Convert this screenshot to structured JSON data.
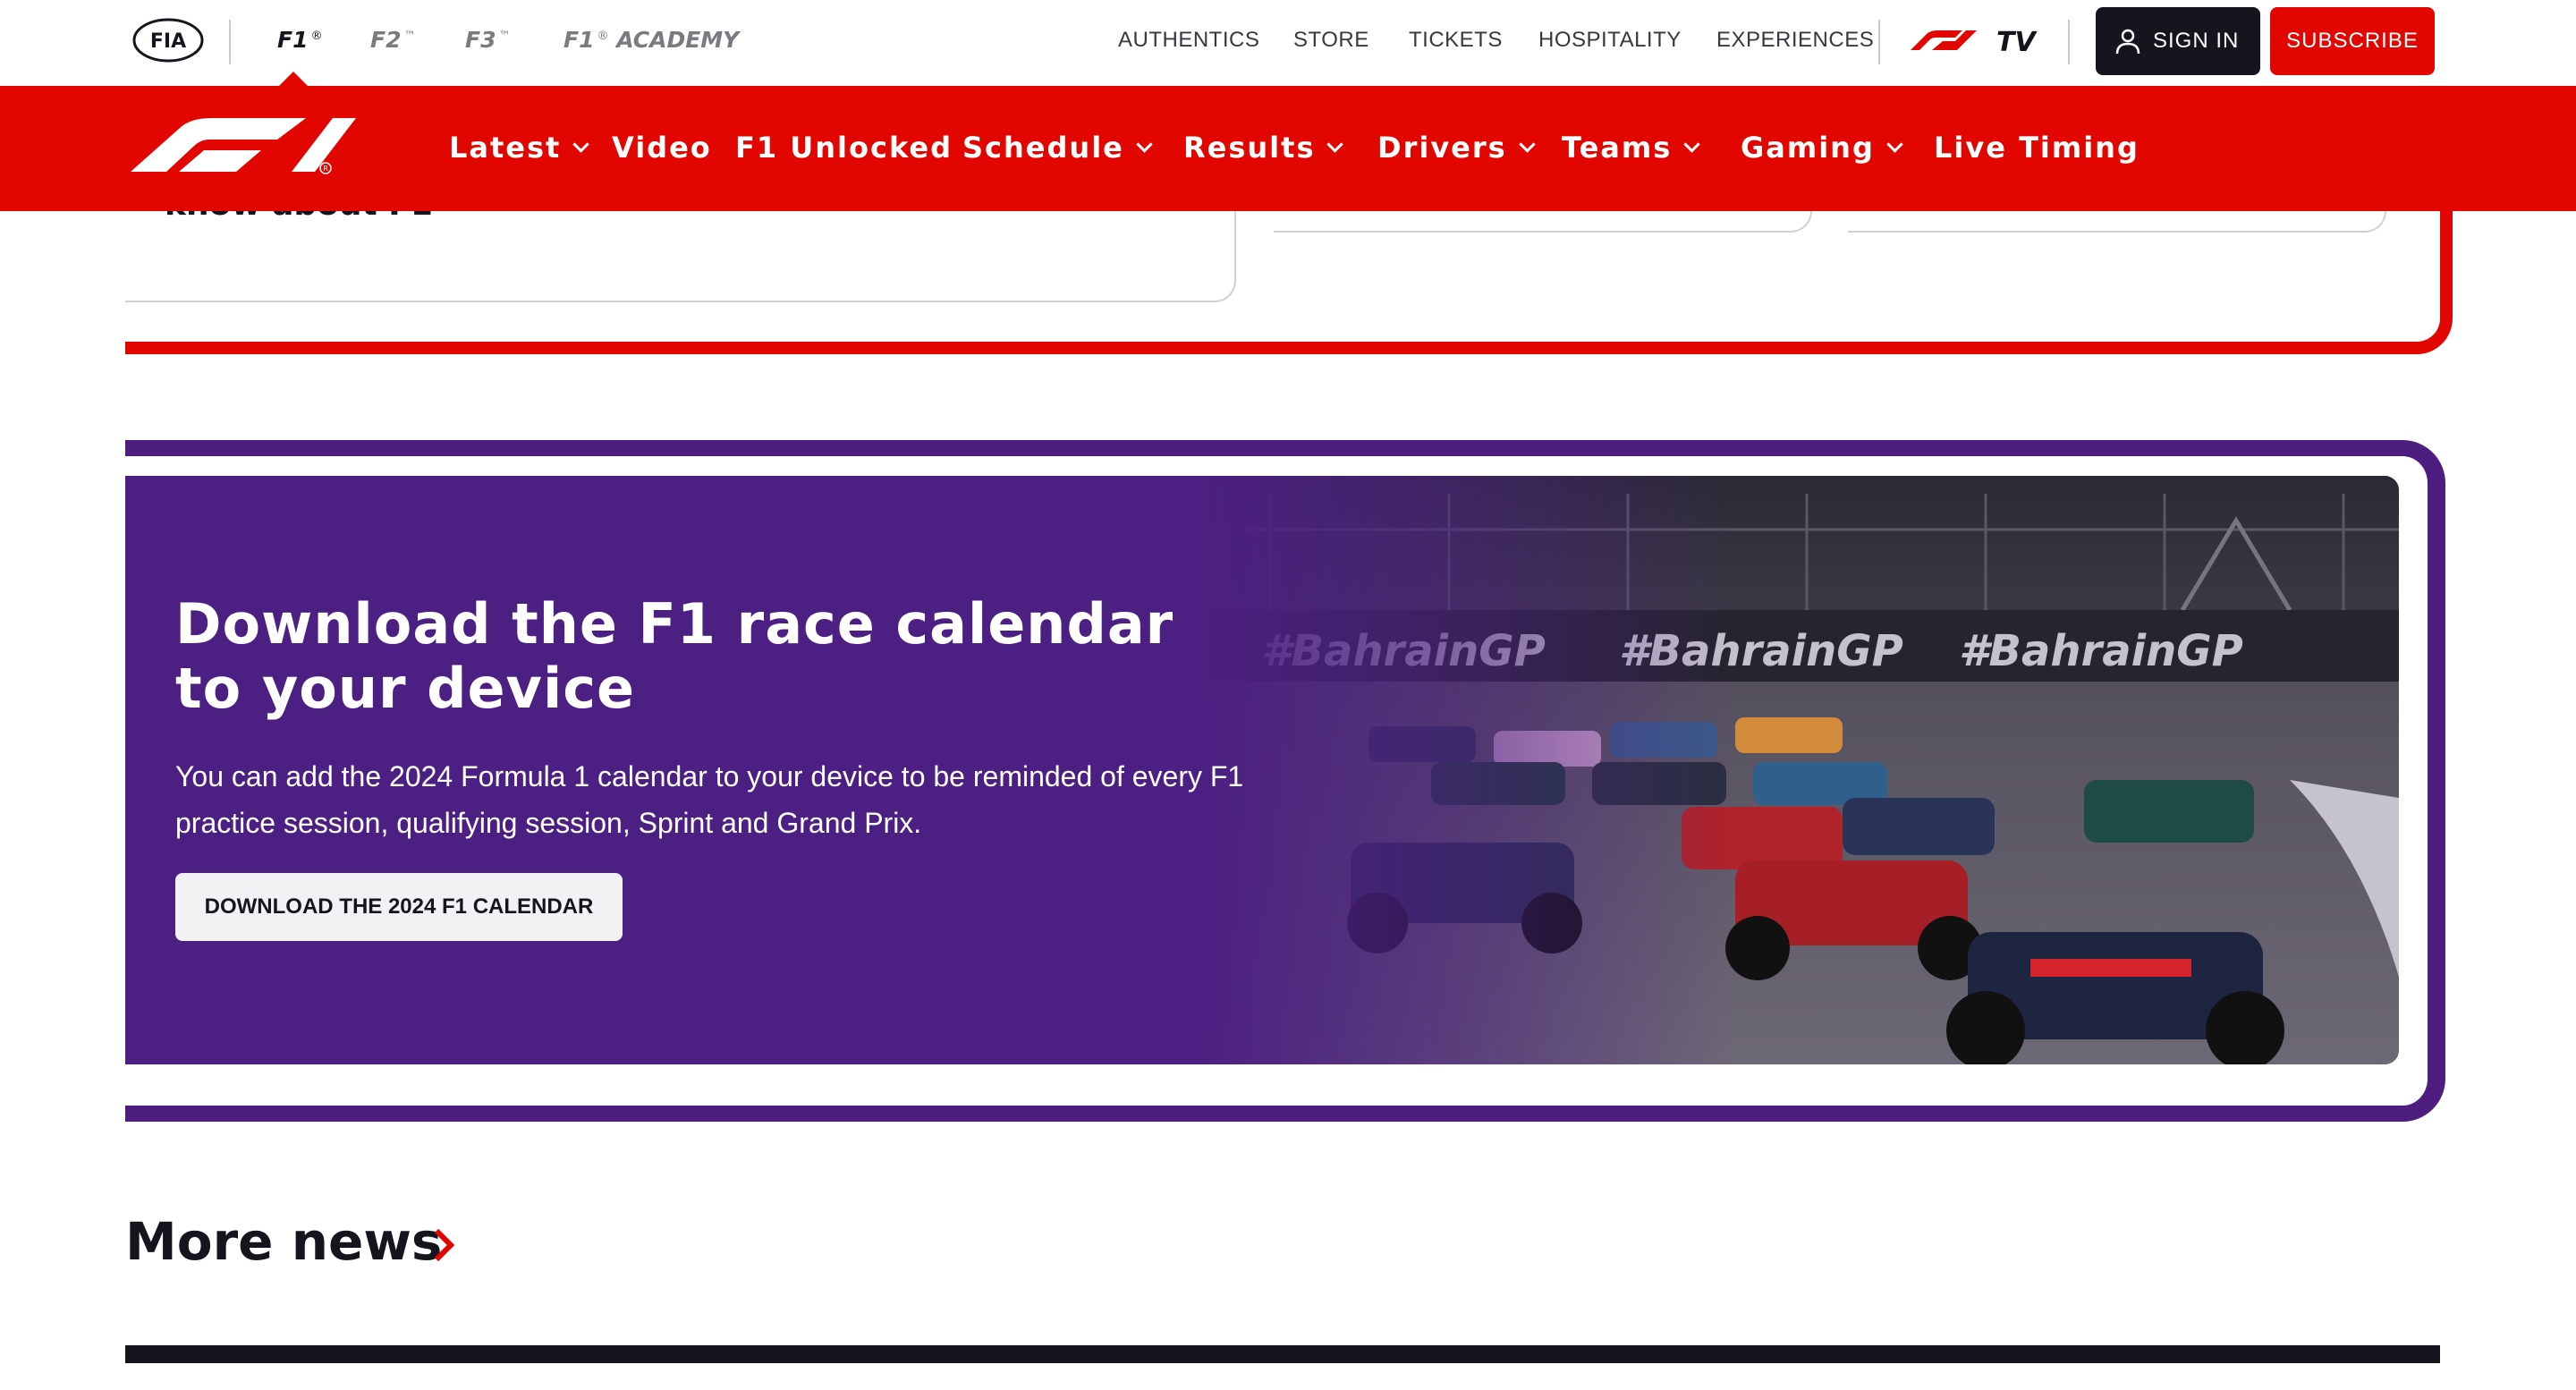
{
  "topbar": {
    "fia_logo_text": "FIA",
    "series": [
      {
        "label": "F1",
        "mark": "®"
      },
      {
        "label": "F2",
        "mark": "™"
      },
      {
        "label": "F3",
        "mark": "™"
      },
      {
        "label": "F1",
        "mark": "®",
        "suffix": "ACADEMY"
      }
    ],
    "links": [
      "AUTHENTICS",
      "STORE",
      "TICKETS",
      "HOSPITALITY",
      "EXPERIENCES"
    ],
    "f1tv_label": "TV",
    "signin_label": "SIGN IN",
    "subscribe_label": "SUBSCRIBE"
  },
  "nav": {
    "items": [
      {
        "label": "Latest",
        "dropdown": true
      },
      {
        "label": "Video",
        "dropdown": false
      },
      {
        "label": "F1 Unlocked",
        "dropdown": false
      },
      {
        "label": "Schedule",
        "dropdown": true
      },
      {
        "label": "Results",
        "dropdown": true
      },
      {
        "label": "Drivers",
        "dropdown": true
      },
      {
        "label": "Teams",
        "dropdown": true
      },
      {
        "label": "Gaming",
        "dropdown": true
      },
      {
        "label": "Live Timing",
        "dropdown": false
      }
    ]
  },
  "partial_card": {
    "text": "know about F1"
  },
  "promo": {
    "title_line1": "Download the F1 race calendar",
    "title_line2": "to your device",
    "description": "You can add the 2024 Formula 1 calendar to your device to be reminded of every F1 practice session, qualifying session, Sprint and Grand Prix.",
    "button_label": "DOWNLOAD THE 2024 F1 CALENDAR",
    "banner_text": "#BahrainGP"
  },
  "more_news": {
    "title": "More news"
  },
  "colors": {
    "brand_red": "#e10600",
    "promo_purple": "#4c1f82",
    "dark": "#15151e"
  }
}
